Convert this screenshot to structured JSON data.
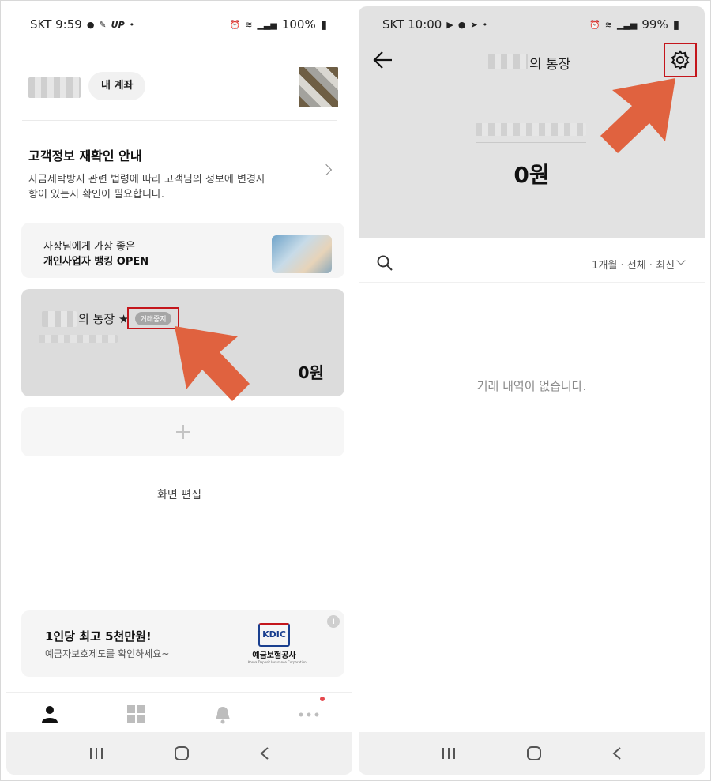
{
  "left": {
    "status": {
      "carrier_time": "SKT 9:59",
      "extra": "UP",
      "battery": "100%"
    },
    "header": {
      "my_accounts_chip": "내 계좌"
    },
    "notice": {
      "title": "고객정보 재확인 안내",
      "body": "자금세탁방지 관련 법령에 따라 고객님의 정보에 변경사항이 있는지 확인이 필요합니다."
    },
    "promo": {
      "line1": "사장님에게 가장 좋은",
      "line2": "개인사업자 뱅킹 OPEN"
    },
    "account": {
      "name_suffix": "의 통장 ★",
      "status_badge": "거래중지",
      "balance": "0원"
    },
    "edit_screen": "화면 편집",
    "deposit_insurance": {
      "title": "1인당 최고 5천만원!",
      "subtitle": "예금자보호제도를 확인하세요~",
      "logo_text": "KDIC",
      "logo_name": "예금보험공사",
      "logo_sub": "Korea Deposit Insurance Corporation"
    },
    "tabs": [
      "profile-icon",
      "grid-icon",
      "bell-icon",
      "more-icon"
    ]
  },
  "right": {
    "status": {
      "carrier_time": "SKT 10:00",
      "battery": "99%"
    },
    "title_suffix": "의 통장",
    "balance": "0원",
    "filter": "1개월 · 전체 · 최신",
    "empty_message": "거래 내역이 없습니다."
  },
  "colors": {
    "highlight_box": "#c4161c",
    "arrow": "#e0623f",
    "card_gray": "#dcdcdc"
  }
}
